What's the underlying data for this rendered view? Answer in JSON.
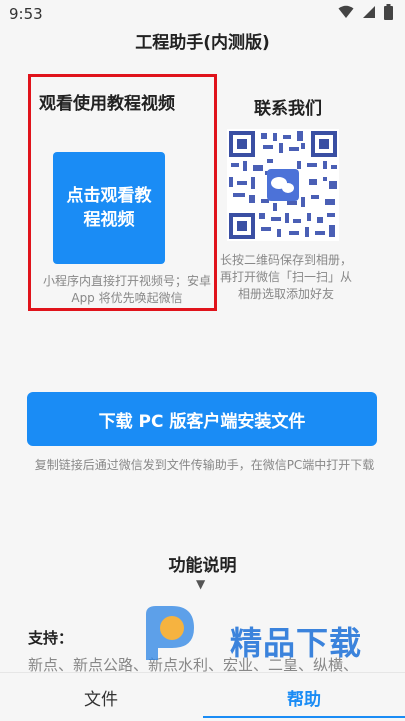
{
  "status_bar": {
    "time": "9:53",
    "icons": [
      "wifi-icon",
      "signal-icon",
      "battery-icon"
    ]
  },
  "header": {
    "title": "工程助手(内测版)"
  },
  "tutorial": {
    "heading": "观看使用教程视频",
    "button_label": "点击观看教程视频",
    "note": "小程序内直接打开视频号；安卓 App 将优先唤起微信"
  },
  "contact": {
    "heading": "联系我们",
    "note": "长按二维码保存到相册，再打开微信「扫一扫」从相册选取添加好友"
  },
  "download": {
    "button_label": "下载 PC 版客户端安装文件",
    "note": "复制链接后通过微信发到文件传输助手，在微信PC端中打开下载"
  },
  "features": {
    "title": "功能说明",
    "support_label": "支持：",
    "support_list": "新点、新点公路、新点水利、宏业、二皇、纵横、"
  },
  "watermark": {
    "text": "精品下载"
  },
  "tabs": [
    {
      "label": "文件"
    },
    {
      "label": "帮助"
    }
  ],
  "colors": {
    "accent": "#1a8cf5",
    "highlight_border": "#e0131b"
  }
}
